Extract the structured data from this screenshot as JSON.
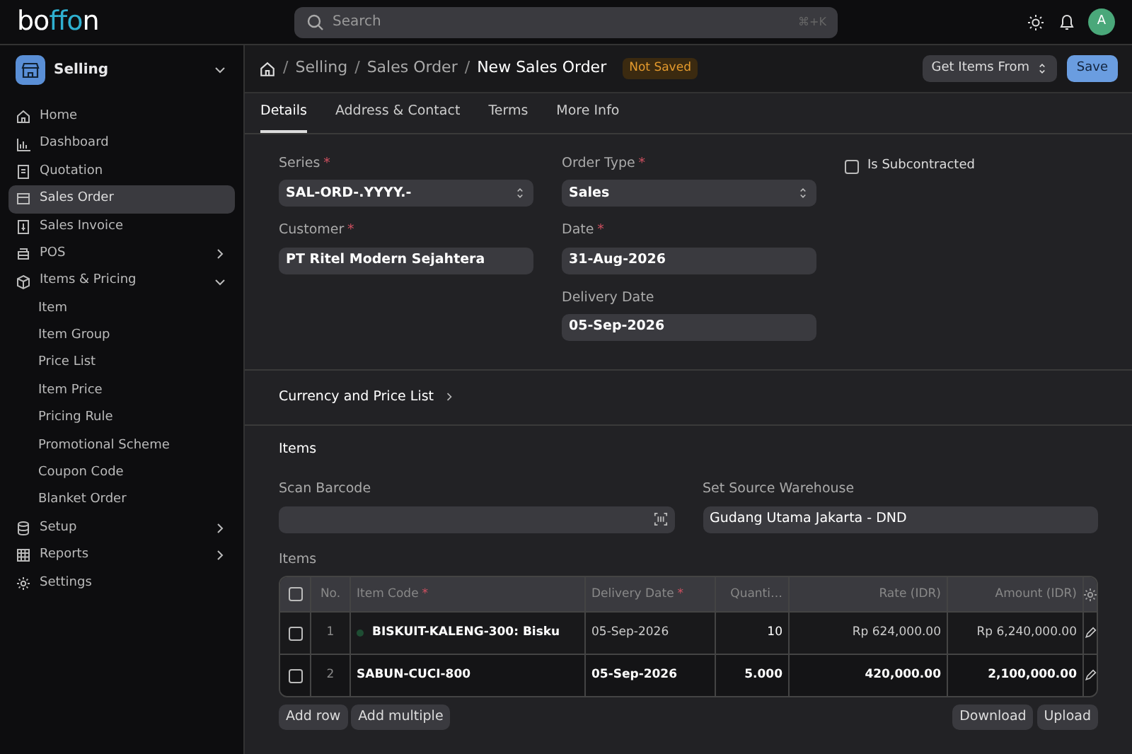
{
  "topbar": {
    "logo": "boffon",
    "search": {
      "placeholder": "Search",
      "shortcut": "⌘+K"
    },
    "avatar": "A"
  },
  "sidebar": {
    "workspace": "Selling",
    "items": [
      {
        "label": "Home",
        "selected": false,
        "kind": "link"
      },
      {
        "label": "Dashboard",
        "selected": false,
        "kind": "link"
      },
      {
        "label": "Quotation",
        "selected": false,
        "kind": "link"
      },
      {
        "label": "Sales Order",
        "selected": true,
        "kind": "link"
      },
      {
        "label": "Sales Invoice",
        "selected": false,
        "kind": "link"
      },
      {
        "label": "POS",
        "selected": false,
        "kind": "group",
        "expanded": false
      },
      {
        "label": "Items & Pricing",
        "selected": false,
        "kind": "group",
        "expanded": true,
        "children": [
          {
            "label": "Item",
            "selected": false
          },
          {
            "label": "Item Group",
            "selected": false
          },
          {
            "label": "Price List",
            "selected": false
          },
          {
            "label": "Item Price",
            "selected": false
          },
          {
            "label": "Pricing Rule",
            "selected": false
          },
          {
            "label": "Promotional Scheme",
            "selected": false
          },
          {
            "label": "Coupon Code",
            "selected": false
          },
          {
            "label": "Blanket Order",
            "selected": false
          }
        ]
      },
      {
        "label": "Setup",
        "selected": false,
        "kind": "group",
        "expanded": false
      },
      {
        "label": "Reports",
        "selected": false,
        "kind": "group",
        "expanded": false
      },
      {
        "label": "Settings",
        "selected": false,
        "kind": "link"
      }
    ]
  },
  "breadcrumbs": [
    {
      "separator": "/",
      "label": "Selling"
    },
    {
      "separator": "/",
      "label": "Sales Order"
    }
  ],
  "title_separator": "/",
  "page_title": "New Sales Order",
  "status": "Not Saved",
  "actions": {
    "secondary": "Get Items From",
    "primary": "Save"
  },
  "tabs": [
    {
      "label": "Details",
      "selected": true
    },
    {
      "label": "Address & Contact",
      "selected": false
    },
    {
      "label": "Terms",
      "selected": false
    },
    {
      "label": "More Info",
      "selected": false
    }
  ],
  "form": {
    "series": {
      "label": "Series",
      "required_mark": "*",
      "value": "SAL-ORD-.YYYY.-"
    },
    "customer": {
      "label": "Customer",
      "required_mark": "*",
      "value": "PT Ritel Modern Sejahtera"
    },
    "order_type": {
      "label": "Order Type",
      "required_mark": "*",
      "value": "Sales"
    },
    "date": {
      "label": "Date",
      "required_mark": "*",
      "value": "31-Aug-2026"
    },
    "delivery_date": {
      "label": "Delivery Date",
      "value": "05-Sep-2026"
    },
    "is_subcontracted": {
      "label": "Is Subcontracted",
      "checked": false
    }
  },
  "currency_section": {
    "title": "Currency and Price List",
    "expanded": false
  },
  "items_section": {
    "title": "Items",
    "scan_barcode": {
      "label": "Scan Barcode"
    },
    "source_warehouse": {
      "label": "Set Source Warehouse",
      "value": "Gudang Utama Jakarta - DND"
    },
    "table_label": "Items",
    "select_all_checked": false,
    "columns": [
      {
        "label": "No."
      },
      {
        "label": "Item Code",
        "required_mark": "*"
      },
      {
        "label": "Delivery Date",
        "required_mark": "*"
      },
      {
        "label": "Quanti…"
      },
      {
        "label": "Rate (IDR)"
      },
      {
        "label": "Amount (IDR)"
      }
    ],
    "rows": [
      {
        "no": "1",
        "item_code": "BISKUIT-KALENG-300: Bisku",
        "delivery_date": "05-Sep-2026",
        "quantity": "10",
        "rate": "Rp 624,000.00",
        "amount": "Rp 6,240,000.00",
        "editing": false,
        "checked": false,
        "color": "#1e4d33"
      },
      {
        "no": "2",
        "item_code": "SABUN-CUCI-800",
        "delivery_date": "05-Sep-2026",
        "quantity": "5.000",
        "rate": "420,000.00",
        "amount": "2,100,000.00",
        "editing": true,
        "checked": false
      }
    ],
    "left_buttons": [
      "Add row",
      "Add multiple"
    ],
    "right_buttons": [
      "Download",
      "Upload"
    ]
  }
}
